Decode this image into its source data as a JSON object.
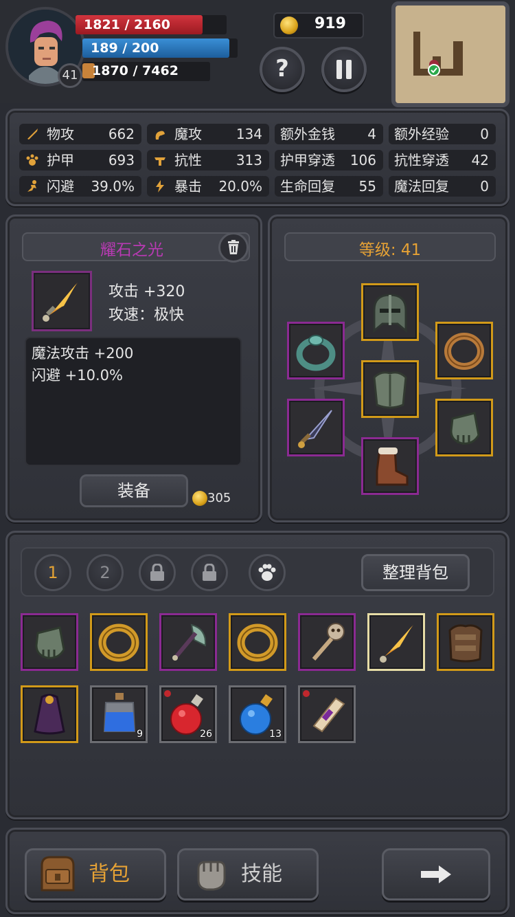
{
  "player": {
    "level": "41",
    "hp": "1821 / 2160",
    "hp_fraction": 0.843,
    "mp": "189 / 200",
    "mp_fraction": 0.945,
    "xp": "1870 / 7462",
    "xp_fraction": 0.25,
    "gold": "919"
  },
  "header_buttons": {
    "help_label": "?",
    "pause_icon": "pause-icon"
  },
  "stats": [
    {
      "icon": "sword-icon",
      "label": "物攻",
      "value": "662"
    },
    {
      "icon": "magic-icon",
      "label": "魔攻",
      "value": "134"
    },
    {
      "icon": "",
      "label": "额外金钱",
      "value": "4"
    },
    {
      "icon": "",
      "label": "额外经验",
      "value": "0"
    },
    {
      "icon": "paw-armor-icon",
      "label": "护甲",
      "value": "693"
    },
    {
      "icon": "resist-icon",
      "label": "抗性",
      "value": "313"
    },
    {
      "icon": "",
      "label": "护甲穿透",
      "value": "106"
    },
    {
      "icon": "",
      "label": "抗性穿透",
      "value": "42"
    },
    {
      "icon": "dodge-icon",
      "label": "闪避",
      "value": "39.0%"
    },
    {
      "icon": "crit-icon",
      "label": "暴击",
      "value": "20.0%"
    },
    {
      "icon": "",
      "label": "生命回复",
      "value": "55"
    },
    {
      "icon": "",
      "label": "魔法回复",
      "value": "0"
    }
  ],
  "selected_item": {
    "name": "耀石之光",
    "name_color": "#b93ab4",
    "attack": "攻击 +320",
    "attack_speed": "攻速：极快",
    "bonuses": [
      "魔法攻击 +200",
      "闪避 +10.0%"
    ],
    "equip_label": "装备",
    "price": "305"
  },
  "equipment": {
    "level_label": "等级: 41",
    "slots": [
      {
        "name": "helmet",
        "rarity": "gold",
        "icon": "helmet-icon"
      },
      {
        "name": "ring-left",
        "rarity": "purple",
        "icon": "teal-ring-icon"
      },
      {
        "name": "ring-right",
        "rarity": "gold",
        "icon": "bronze-ring-icon"
      },
      {
        "name": "chest",
        "rarity": "gold",
        "icon": "chest-armor-icon"
      },
      {
        "name": "weapon",
        "rarity": "purple",
        "icon": "dark-dagger-icon"
      },
      {
        "name": "gloves",
        "rarity": "gold",
        "icon": "gauntlet-icon"
      },
      {
        "name": "boots",
        "rarity": "purple",
        "icon": "boots-icon"
      }
    ]
  },
  "inventory": {
    "tabs": [
      "1",
      "2"
    ],
    "locked_tab_icons": [
      "lock-icon",
      "lock-icon"
    ],
    "paw_tab_icon": "paw-icon",
    "sort_label": "整理背包",
    "items": [
      {
        "icon": "gauntlet-icon",
        "rarity": "purple",
        "count": ""
      },
      {
        "icon": "gold-ring-icon",
        "rarity": "gold",
        "count": ""
      },
      {
        "icon": "axe-icon",
        "rarity": "purple",
        "count": ""
      },
      {
        "icon": "gold-ring-icon",
        "rarity": "gold",
        "count": ""
      },
      {
        "icon": "skull-staff-icon",
        "rarity": "purple",
        "count": ""
      },
      {
        "icon": "flame-dagger-icon",
        "rarity": "sel",
        "count": ""
      },
      {
        "icon": "leather-armor-icon",
        "rarity": "gold",
        "count": ""
      },
      {
        "icon": "purple-cloak-icon",
        "rarity": "gold",
        "count": ""
      },
      {
        "icon": "blue-potion-icon",
        "rarity": "gray",
        "count": "9"
      },
      {
        "icon": "red-potion-icon",
        "rarity": "gray",
        "count": "26"
      },
      {
        "icon": "blue-round-potion-icon",
        "rarity": "gray",
        "count": "13"
      },
      {
        "icon": "scroll-icon",
        "rarity": "gray",
        "count": ""
      }
    ]
  },
  "nav": {
    "bag_label": "背包",
    "skill_label": "技能",
    "arrow_icon": "arrow-right-icon"
  }
}
